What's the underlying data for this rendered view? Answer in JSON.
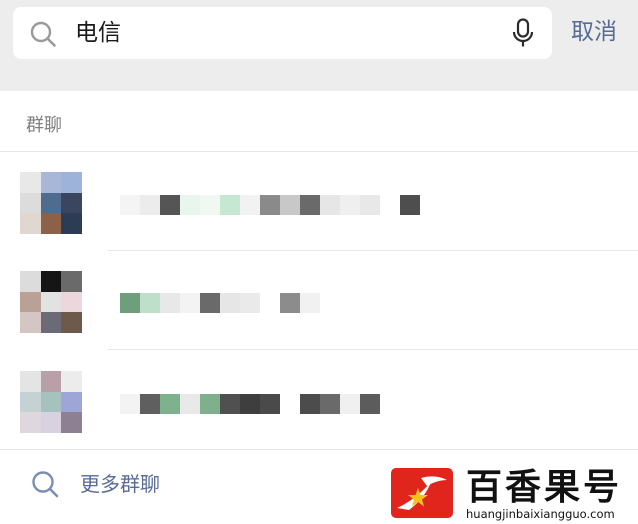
{
  "search": {
    "query": "电信",
    "cancel_label": "取消"
  },
  "results": {
    "section_title": "群聊",
    "rows": [
      {
        "avatar_colors": [
          "#e8e8e8",
          "#a8b6d8",
          "#9db3d9",
          "#dcdcdc",
          "#4f6c8f",
          "#3a4660",
          "#e0d8d0",
          "#8b6248",
          "#2d3c55"
        ],
        "name_blocks": [
          "#f4f4f4",
          "#ececec",
          "#555555",
          "#e8f6ee",
          "#f0f8f2",
          "#c6e8d2",
          "#f2f2f2",
          "#8a8a8a",
          "#c8c8c8",
          "#6a6a6a",
          "#e6e6e6",
          "#efefef",
          "#e8e8e8",
          "#ffffff",
          "#4e4e4e"
        ]
      },
      {
        "avatar_colors": [
          "#dcdcdc",
          "#151515",
          "#6a6a6a",
          "#b9a195",
          "#e2e2e2",
          "#ecd8dc",
          "#d4c6c2",
          "#6b6b78",
          "#6e5a4a"
        ],
        "name_blocks": [
          "#6f9e7c",
          "#bedfca",
          "#e8e8e8",
          "#f3f3f3",
          "#6a6a6a",
          "#e6e6e6",
          "#eaeaea",
          "#ffffff",
          "#8c8c8c",
          "#f1f1f1"
        ]
      },
      {
        "avatar_colors": [
          "#e4e4e4",
          "#b9a0a8",
          "#ececec",
          "#c4d2d4",
          "#a6c2bf",
          "#9ea6d8",
          "#ded8de",
          "#d8d2e0",
          "#8c8092"
        ],
        "name_blocks": [
          "#f3f3f3",
          "#5f5f5f",
          "#7eb18e",
          "#e9e9e9",
          "#7fb08c",
          "#505050",
          "#3e3e3e",
          "#4a4a4a",
          "#ffffff",
          "#4c4c4c",
          "#6a6a6a",
          "#f0f0f0",
          "#5c5c5c"
        ]
      }
    ],
    "more_label": "更多群聊"
  },
  "watermark": {
    "title": "百香果号",
    "url": "huangjinbaixiangguo.com",
    "logo_color": "#e0261c"
  }
}
